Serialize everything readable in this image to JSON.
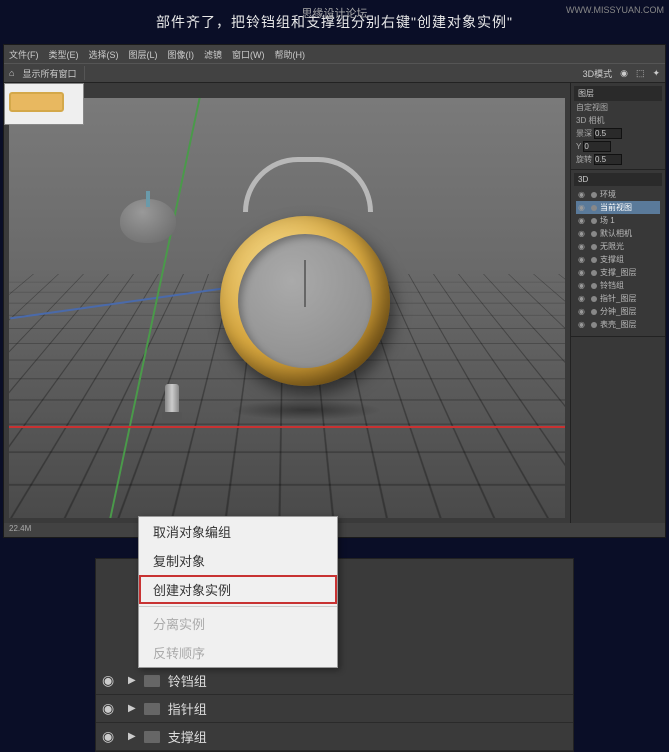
{
  "watermark_right": "WWW.MISSYUAN.COM",
  "watermark_center": "思缘设计论坛",
  "instruction": "部件齐了，把铃铛组和支撑组分别右键\"创建对象实例\"",
  "menu": {
    "items": [
      "文件(F)",
      "类型(E)",
      "选择(S)",
      "图层(L)",
      "图像(I)",
      "滤镜",
      "窗口(W)",
      "帮助(H)"
    ]
  },
  "toolbar": {
    "mode": "3D模式",
    "show": "显示所有窗口"
  },
  "panels": {
    "view_title": "图层",
    "camera": "自定视图",
    "coord": "3D 相机",
    "props": [
      [
        "景深",
        "0.5"
      ],
      [
        "Y",
        "0"
      ],
      [
        "旋转",
        "0.5"
      ]
    ],
    "tree_title": "3D",
    "tree": [
      {
        "label": "环境",
        "sel": false
      },
      {
        "label": "当前视图",
        "sel": true
      },
      {
        "label": "场 1",
        "sel": false
      },
      {
        "label": "默认相机",
        "sel": false
      },
      {
        "label": "无限光",
        "sel": false
      },
      {
        "label": "支撑组",
        "sel": false
      },
      {
        "label": "支撑_图层",
        "sel": false
      },
      {
        "label": "铃铛组",
        "sel": false
      },
      {
        "label": "指针_图层",
        "sel": false
      },
      {
        "label": "分钟_图层",
        "sel": false
      },
      {
        "label": "表壳_图层",
        "sel": false
      }
    ]
  },
  "status": "22.4M",
  "context": {
    "cancel": "取消对象编组",
    "copy": "复制对象",
    "instance": "创建对象实例",
    "separate": "分离实例",
    "reverse": "反转顺序"
  },
  "layers": {
    "hidden": "铃铛组",
    "items": [
      "指针组",
      "支撑组"
    ]
  }
}
